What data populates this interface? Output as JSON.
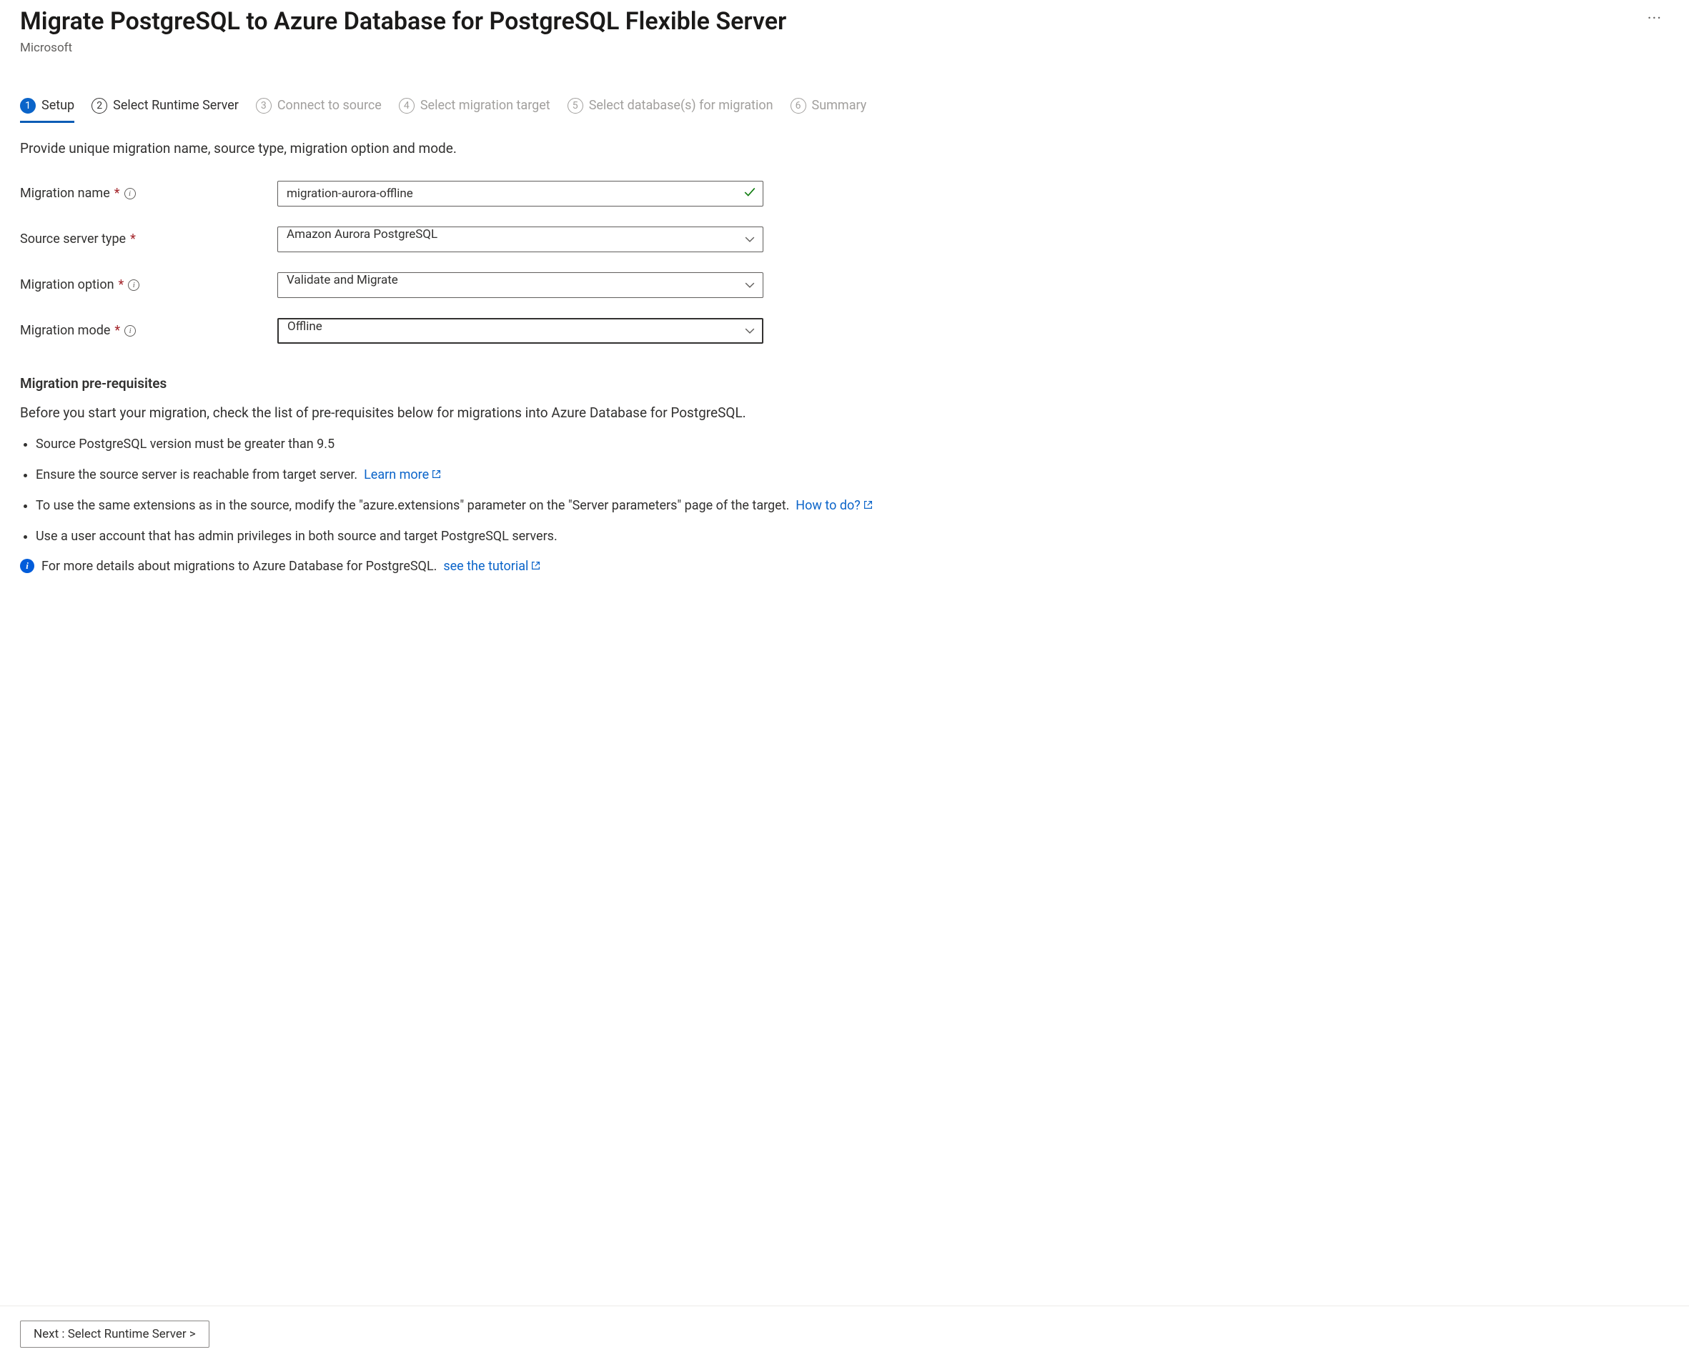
{
  "header": {
    "title": "Migrate PostgreSQL to Azure Database for PostgreSQL Flexible Server",
    "subtitle": "Microsoft"
  },
  "tabs": [
    {
      "num": "1",
      "label": "Setup",
      "state": "active"
    },
    {
      "num": "2",
      "label": "Select Runtime Server",
      "state": "enabled"
    },
    {
      "num": "3",
      "label": "Connect to source",
      "state": "disabled"
    },
    {
      "num": "4",
      "label": "Select migration target",
      "state": "disabled"
    },
    {
      "num": "5",
      "label": "Select database(s) for migration",
      "state": "disabled"
    },
    {
      "num": "6",
      "label": "Summary",
      "state": "disabled"
    }
  ],
  "intro": "Provide unique migration name, source type, migration option and mode.",
  "form": {
    "migration_name": {
      "label": "Migration name",
      "value": "migration-aurora-offline"
    },
    "source_server_type": {
      "label": "Source server type",
      "value": "Amazon Aurora PostgreSQL"
    },
    "migration_option": {
      "label": "Migration option",
      "value": "Validate and Migrate"
    },
    "migration_mode": {
      "label": "Migration mode",
      "value": "Offline"
    }
  },
  "prereq": {
    "heading": "Migration pre-requisites",
    "intro": "Before you start your migration, check the list of pre-requisites below for migrations into Azure Database for PostgreSQL.",
    "item1": "Source PostgreSQL version must be greater than 9.5",
    "item2_text": "Ensure the source server is reachable from target server.",
    "item2_link": "Learn more",
    "item3_text": "To use the same extensions as in the source, modify the \"azure.extensions\" parameter on the \"Server parameters\" page of the target.",
    "item3_link": "How to do?",
    "item4": "Use a user account that has admin privileges in both source and target PostgreSQL servers.",
    "tutorial_text": "For more details about migrations to Azure Database for PostgreSQL.",
    "tutorial_link": "see the tutorial"
  },
  "footer": {
    "next_label": "Next : Select Runtime Server >"
  }
}
